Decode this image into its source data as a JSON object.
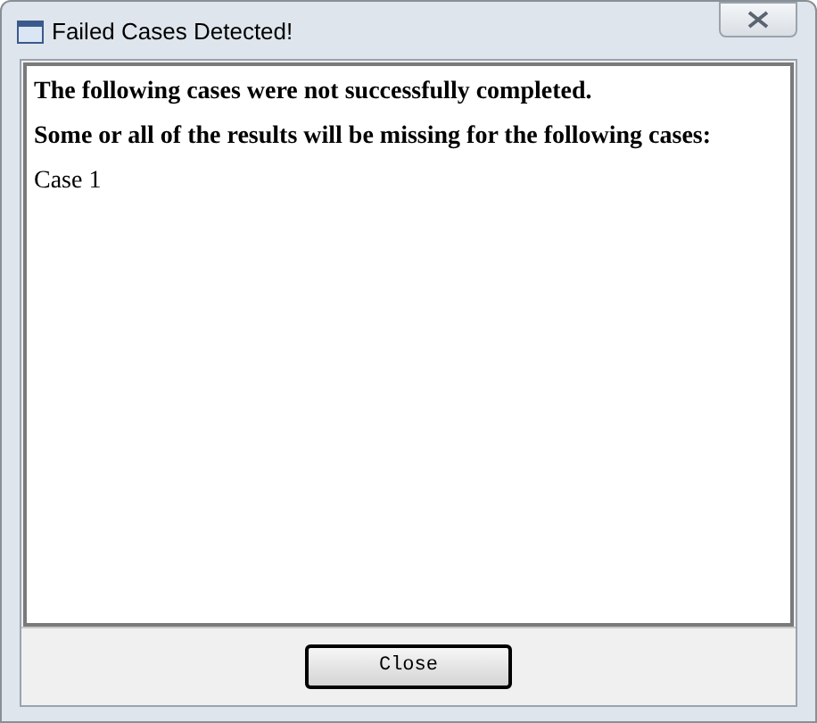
{
  "window": {
    "title": "Failed Cases Detected!"
  },
  "messages": [
    {
      "text": "The following cases were not successfully completed.",
      "bold": true
    },
    {
      "text": "Some or all of the results will be missing for the following cases:",
      "bold": true
    },
    {
      "text": "Case 1",
      "bold": false
    }
  ],
  "buttons": [
    {
      "label": "Close"
    }
  ]
}
